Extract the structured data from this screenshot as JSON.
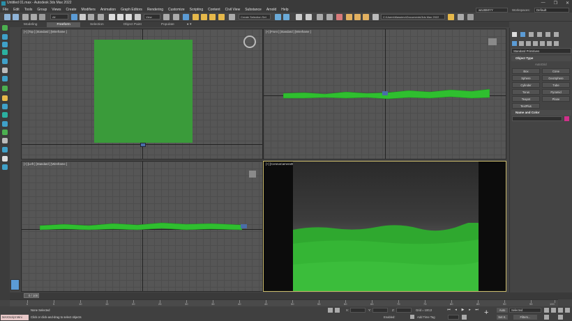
{
  "window": {
    "title": "Untitled 01.max - Autodesk 3ds Max 2022",
    "buttons": [
      "—",
      "❐",
      "✕"
    ]
  },
  "menu": [
    "File",
    "Edit",
    "Tools",
    "Group",
    "Views",
    "Create",
    "Modifiers",
    "Animation",
    "Graph Editors",
    "Rendering",
    "Customize",
    "Scripting",
    "Content",
    "Civil View",
    "Substance",
    "Arnold",
    "Help"
  ],
  "user": {
    "name": "wILtBMYY",
    "workspace_label": "Workspaces:",
    "workspace_value": "Default"
  },
  "toolbar": {
    "filter": "All",
    "view": "View",
    "selection_set": "Create Selection Set",
    "path": "C:\\Users\\Massimo\\Documents\\3ds Max 2022"
  },
  "ribbon": {
    "tabs": [
      "Modeling",
      "Freeform",
      "Selection",
      "Object Paint",
      "Populate"
    ],
    "active": "Freeform"
  },
  "viewports": {
    "top": "[+] [Top ] [Standard ] [Wireframe ]",
    "front": "[+] [Front ] [Standard ] [Wireframe ]",
    "left": "[+] [Left ] [Standard ] [Wireframe ]",
    "camera": "[+] [CoronaCamera001 ] [Standard ] [Default Shading ]"
  },
  "command_panel": {
    "dropdown": "Standard Primitives",
    "object_type_title": "Object Type",
    "autogrid": "AutoGrid",
    "buttons": [
      "Box",
      "Cone",
      "Sphere",
      "GeoSphere",
      "Cylinder",
      "Tube",
      "Torus",
      "Pyramid",
      "Teapot",
      "Plane",
      "TextPlus"
    ],
    "name_color_title": "Name and Color",
    "object_color": "#d0308a"
  },
  "timeline": {
    "frame_label": "0 / 100",
    "ticks": [
      "0",
      "5",
      "10",
      "15",
      "20",
      "25",
      "30",
      "35",
      "40",
      "45",
      "50",
      "55",
      "60",
      "65",
      "70",
      "75",
      "80",
      "85",
      "90",
      "95",
      "100"
    ]
  },
  "status": {
    "maxscript": "MAXScript Mini",
    "selected": "None Selected",
    "prompt": "Click or click-and-drag to select objects",
    "x_label": "X:",
    "y_label": "Y:",
    "z_label": "Z:",
    "grid": "Grid = 100,0",
    "add_time_tag": "Add Time Tag",
    "enabled": "Enabled:",
    "auto": "Auto",
    "setk": "Set K.",
    "selected_drop": "Selected",
    "filters": "Filters..."
  },
  "colors": {
    "terrain": "#2fbf2f",
    "plane": "#3c9a3c",
    "active_border": "#c9b96a",
    "accent": "#5b9bd5"
  }
}
